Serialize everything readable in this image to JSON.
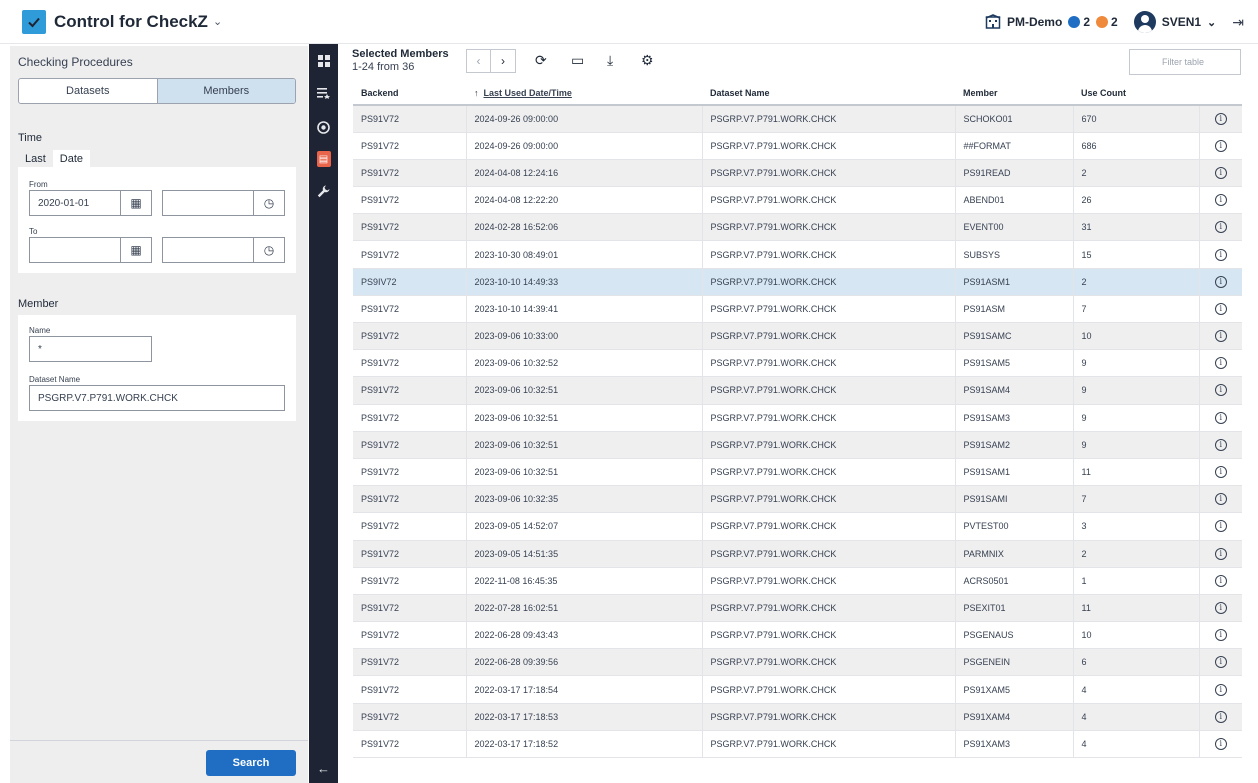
{
  "app": {
    "title": "Control for CheckZ",
    "caret": "⌄",
    "logo_icon": "checkmark-icon"
  },
  "topbar": {
    "env": "PM-Demo",
    "info_count": "2",
    "warn_count": "2",
    "user": "SVEN1",
    "user_caret": "⌄",
    "colors": {
      "info": "#1f6ec4",
      "warn": "#ef8a3c"
    }
  },
  "left": {
    "title": "Checking Procedures",
    "segments": {
      "datasets": "Datasets",
      "members": "Members"
    },
    "time": {
      "label": "Time",
      "tab_last": "Last",
      "tab_date": "Date",
      "from_label": "From",
      "from_date": "2020-01-01",
      "from_time": "",
      "to_label": "To",
      "to_date": "",
      "to_time": ""
    },
    "member": {
      "label": "Member",
      "name_label": "Name",
      "name_value": "*",
      "dataset_label": "Dataset Name",
      "dataset_value": "PSGRP.V7.P791.WORK.CHCK"
    },
    "search_label": "Search"
  },
  "main": {
    "title": "Selected Members",
    "count": "1-24 from 36",
    "filter_placeholder": "Filter table",
    "columns": {
      "backend": "Backend",
      "date": "Last Used Date/Time",
      "dataset": "Dataset Name",
      "member": "Member",
      "use": "Use Count",
      "sort_arrow": "↑"
    },
    "rows": [
      {
        "backend": "PS91V72",
        "date": "2024-09-26 09:00:00",
        "dataset": "PSGRP.V7.P791.WORK.CHCK",
        "member": "SCHOKO01",
        "use": "670"
      },
      {
        "backend": "PS91V72",
        "date": "2024-09-26 09:00:00",
        "dataset": "PSGRP.V7.P791.WORK.CHCK",
        "member": "##FORMAT",
        "use": "686"
      },
      {
        "backend": "PS91V72",
        "date": "2024-04-08 12:24:16",
        "dataset": "PSGRP.V7.P791.WORK.CHCK",
        "member": "PS91READ",
        "use": "2"
      },
      {
        "backend": "PS91V72",
        "date": "2024-04-08 12:22:20",
        "dataset": "PSGRP.V7.P791.WORK.CHCK",
        "member": "ABEND01",
        "use": "26"
      },
      {
        "backend": "PS91V72",
        "date": "2024-02-28 16:52:06",
        "dataset": "PSGRP.V7.P791.WORK.CHCK",
        "member": "EVENT00",
        "use": "31"
      },
      {
        "backend": "PS91V72",
        "date": "2023-10-30 08:49:01",
        "dataset": "PSGRP.V7.P791.WORK.CHCK",
        "member": "SUBSYS",
        "use": "15"
      },
      {
        "backend": "PS9IV72",
        "date": "2023-10-10 14:49:33",
        "dataset": "PSGRP.V7.P791.WORK.CHCK",
        "member": "PS91ASM1",
        "use": "2"
      },
      {
        "backend": "PS91V72",
        "date": "2023-10-10 14:39:41",
        "dataset": "PSGRP.V7.P791.WORK.CHCK",
        "member": "PS91ASM",
        "use": "7"
      },
      {
        "backend": "PS91V72",
        "date": "2023-09-06 10:33:00",
        "dataset": "PSGRP.V7.P791.WORK.CHCK",
        "member": "PS91SAMC",
        "use": "10"
      },
      {
        "backend": "PS91V72",
        "date": "2023-09-06 10:32:52",
        "dataset": "PSGRP.V7.P791.WORK.CHCK",
        "member": "PS91SAM5",
        "use": "9"
      },
      {
        "backend": "PS91V72",
        "date": "2023-09-06 10:32:51",
        "dataset": "PSGRP.V7.P791.WORK.CHCK",
        "member": "PS91SAM4",
        "use": "9"
      },
      {
        "backend": "PS91V72",
        "date": "2023-09-06 10:32:51",
        "dataset": "PSGRP.V7.P791.WORK.CHCK",
        "member": "PS91SAM3",
        "use": "9"
      },
      {
        "backend": "PS91V72",
        "date": "2023-09-06 10:32:51",
        "dataset": "PSGRP.V7.P791.WORK.CHCK",
        "member": "PS91SAM2",
        "use": "9"
      },
      {
        "backend": "PS91V72",
        "date": "2023-09-06 10:32:51",
        "dataset": "PSGRP.V7.P791.WORK.CHCK",
        "member": "PS91SAM1",
        "use": "11"
      },
      {
        "backend": "PS91V72",
        "date": "2023-09-06 10:32:35",
        "dataset": "PSGRP.V7.P791.WORK.CHCK",
        "member": "PS91SAMI",
        "use": "7"
      },
      {
        "backend": "PS91V72",
        "date": "2023-09-05 14:52:07",
        "dataset": "PSGRP.V7.P791.WORK.CHCK",
        "member": "PVTEST00",
        "use": "3"
      },
      {
        "backend": "PS91V72",
        "date": "2023-09-05 14:51:35",
        "dataset": "PSGRP.V7.P791.WORK.CHCK",
        "member": "PARMNIX",
        "use": "2"
      },
      {
        "backend": "PS91V72",
        "date": "2022-11-08 16:45:35",
        "dataset": "PSGRP.V7.P791.WORK.CHCK",
        "member": "ACRS0501",
        "use": "1"
      },
      {
        "backend": "PS91V72",
        "date": "2022-07-28 16:02:51",
        "dataset": "PSGRP.V7.P791.WORK.CHCK",
        "member": "PSEXIT01",
        "use": "11"
      },
      {
        "backend": "PS91V72",
        "date": "2022-06-28 09:43:43",
        "dataset": "PSGRP.V7.P791.WORK.CHCK",
        "member": "PSGENAUS",
        "use": "10"
      },
      {
        "backend": "PS91V72",
        "date": "2022-06-28 09:39:56",
        "dataset": "PSGRP.V7.P791.WORK.CHCK",
        "member": "PSGENEIN",
        "use": "6"
      },
      {
        "backend": "PS91V72",
        "date": "2022-03-17 17:18:54",
        "dataset": "PSGRP.V7.P791.WORK.CHCK",
        "member": "PS91XAM5",
        "use": "4"
      },
      {
        "backend": "PS91V72",
        "date": "2022-03-17 17:18:53",
        "dataset": "PSGRP.V7.P791.WORK.CHCK",
        "member": "PS91XAM4",
        "use": "4"
      },
      {
        "backend": "PS91V72",
        "date": "2022-03-17 17:18:52",
        "dataset": "PSGRP.V7.P791.WORK.CHCK",
        "member": "PS91XAM3",
        "use": "4"
      }
    ],
    "selected_row": 6
  },
  "icons": {
    "rail": [
      "dashboard-icon",
      "starred-list-icon",
      "target-icon",
      "document-icon",
      "wrench-icon"
    ],
    "collapse": "arrow-left-icon"
  }
}
